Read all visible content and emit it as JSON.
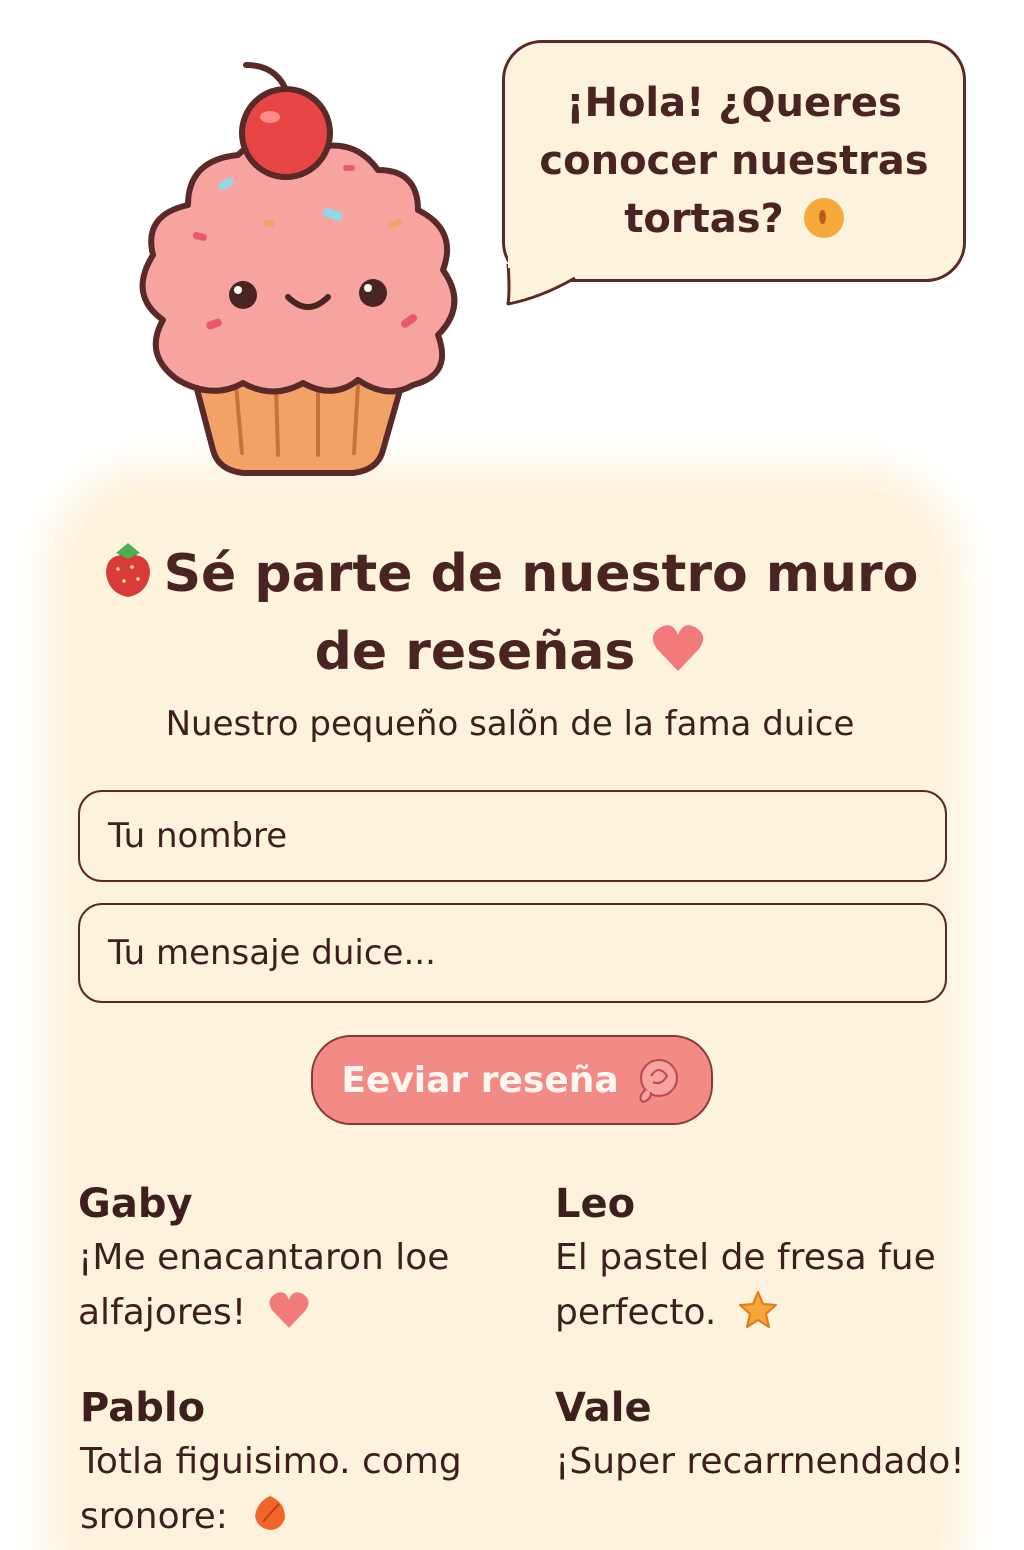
{
  "bubble": {
    "text": "¡Hola! ¿Queres conocer nuestras tortas?"
  },
  "heading": {
    "title": "Sé parte de nuestro muro de reseñas",
    "subtitle": "Nuestro pequeño salõn de la fama duice"
  },
  "form": {
    "name_placeholder": "Tu nombre",
    "message_placeholder": "Tu mensaje duice...",
    "submit_label": "Eeviar reseña"
  },
  "reviews": [
    {
      "name": "Gaby",
      "message": "¡Me enacantaron loe alfajores!",
      "icon": "heart-icon"
    },
    {
      "name": "Leo",
      "message": "El pastel de fresa fue perfecto.",
      "icon": "star-icon"
    },
    {
      "name": "Pablo",
      "message": "Totla figuisimo. comg sronore:",
      "icon": "leaf-icon"
    },
    {
      "name": "Vale",
      "message": "¡Super recarrnendado!",
      "icon": ""
    }
  ],
  "colors": {
    "cream": "#fdf3dc",
    "brown_text": "#4a2423",
    "button_pink": "#f28b85",
    "frosting_pink": "#f7a3a0"
  }
}
